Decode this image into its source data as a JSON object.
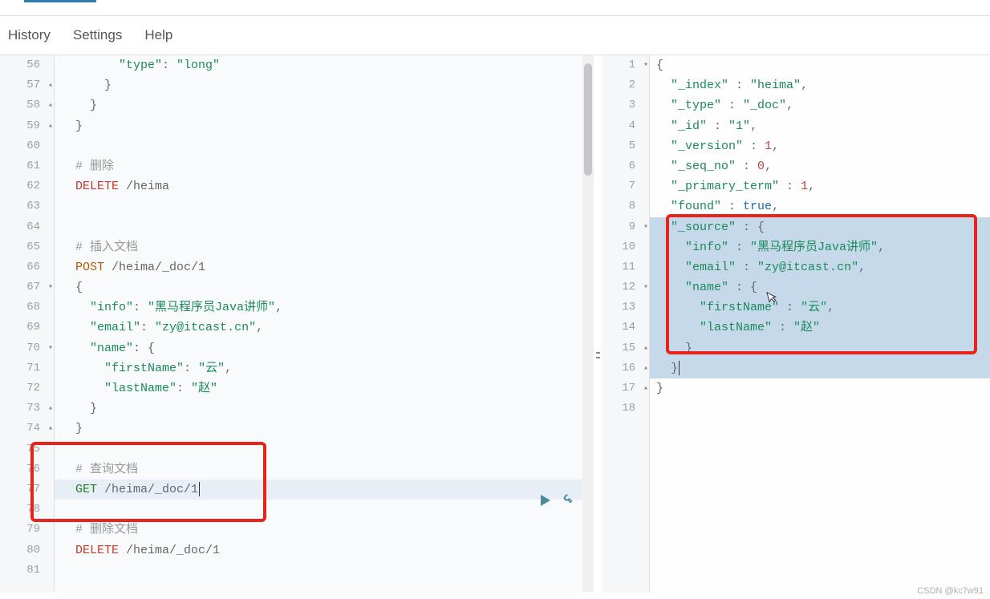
{
  "menu": {
    "history": "History",
    "settings": "Settings",
    "help": "Help"
  },
  "left": {
    "lines": {
      "56": {
        "indent": "        ",
        "tokens": [
          [
            "str",
            "\"type\""
          ],
          [
            "pun",
            ": "
          ],
          [
            "str",
            "\"long\""
          ]
        ]
      },
      "57": {
        "fold": "▴",
        "indent": "      ",
        "tokens": [
          [
            "pun",
            "}"
          ]
        ]
      },
      "58": {
        "fold": "▴",
        "indent": "    ",
        "tokens": [
          [
            "pun",
            "}"
          ]
        ]
      },
      "59": {
        "fold": "▴",
        "indent": "  ",
        "tokens": [
          [
            "pun",
            "}"
          ]
        ]
      },
      "60": {
        "indent": "",
        "tokens": []
      },
      "61": {
        "indent": "  ",
        "tokens": [
          [
            "cmt",
            "# 删除"
          ]
        ]
      },
      "62": {
        "indent": "  ",
        "tokens": [
          [
            "kw-delete",
            "DELETE"
          ],
          [
            "path",
            " /heima"
          ]
        ]
      },
      "63": {
        "indent": "",
        "tokens": []
      },
      "64": {
        "indent": "",
        "tokens": []
      },
      "65": {
        "indent": "  ",
        "tokens": [
          [
            "cmt",
            "# 插入文档"
          ]
        ]
      },
      "66": {
        "indent": "  ",
        "tokens": [
          [
            "kw-post",
            "POST"
          ],
          [
            "path",
            " /heima/_doc/1"
          ]
        ]
      },
      "67": {
        "fold": "▾",
        "indent": "  ",
        "tokens": [
          [
            "pun",
            "{"
          ]
        ]
      },
      "68": {
        "indent": "    ",
        "tokens": [
          [
            "str",
            "\"info\""
          ],
          [
            "pun",
            ": "
          ],
          [
            "str",
            "\"黑马程序员Java讲师\""
          ],
          [
            "pun",
            ","
          ]
        ]
      },
      "69": {
        "indent": "    ",
        "tokens": [
          [
            "str",
            "\"email\""
          ],
          [
            "pun",
            ": "
          ],
          [
            "str",
            "\"zy@itcast.cn\""
          ],
          [
            "pun",
            ","
          ]
        ]
      },
      "70": {
        "fold": "▾",
        "indent": "    ",
        "tokens": [
          [
            "str",
            "\"name\""
          ],
          [
            "pun",
            ": {"
          ]
        ]
      },
      "71": {
        "indent": "      ",
        "tokens": [
          [
            "str",
            "\"firstName\""
          ],
          [
            "pun",
            ": "
          ],
          [
            "str",
            "\"云\""
          ],
          [
            "pun",
            ","
          ]
        ]
      },
      "72": {
        "indent": "      ",
        "tokens": [
          [
            "str",
            "\"lastName\""
          ],
          [
            "pun",
            ": "
          ],
          [
            "str",
            "\"赵\""
          ]
        ]
      },
      "73": {
        "fold": "▴",
        "indent": "    ",
        "tokens": [
          [
            "pun",
            "}"
          ]
        ]
      },
      "74": {
        "fold": "▴",
        "indent": "  ",
        "tokens": [
          [
            "pun",
            "}"
          ]
        ]
      },
      "75": {
        "indent": "",
        "tokens": []
      },
      "76": {
        "indent": "  ",
        "tokens": [
          [
            "cmt",
            "# 查询文档"
          ]
        ]
      },
      "77": {
        "indent": "  ",
        "tokens": [
          [
            "kw-get",
            "GET"
          ],
          [
            "path",
            " /heima/_doc/1"
          ]
        ]
      },
      "78": {
        "indent": "",
        "tokens": []
      },
      "79": {
        "indent": "  ",
        "tokens": [
          [
            "cmt",
            "# 删除文档"
          ]
        ]
      },
      "80": {
        "indent": "  ",
        "tokens": [
          [
            "kw-delete",
            "DELETE"
          ],
          [
            "path",
            " /heima/_doc/1"
          ]
        ]
      },
      "81": {
        "indent": "",
        "tokens": []
      }
    }
  },
  "right": {
    "lines": {
      "1": {
        "fold": "▾",
        "indent": "",
        "tokens": [
          [
            "pun",
            "{"
          ]
        ]
      },
      "2": {
        "indent": "  ",
        "tokens": [
          [
            "key",
            "\"_index\""
          ],
          [
            "pun",
            " : "
          ],
          [
            "str",
            "\"heima\""
          ],
          [
            "pun",
            ","
          ]
        ]
      },
      "3": {
        "indent": "  ",
        "tokens": [
          [
            "key",
            "\"_type\""
          ],
          [
            "pun",
            " : "
          ],
          [
            "str",
            "\"_doc\""
          ],
          [
            "pun",
            ","
          ]
        ]
      },
      "4": {
        "indent": "  ",
        "tokens": [
          [
            "key",
            "\"_id\""
          ],
          [
            "pun",
            " : "
          ],
          [
            "str",
            "\"1\""
          ],
          [
            "pun",
            ","
          ]
        ]
      },
      "5": {
        "indent": "  ",
        "tokens": [
          [
            "key",
            "\"_version\""
          ],
          [
            "pun",
            " : "
          ],
          [
            "num",
            "1"
          ],
          [
            "pun",
            ","
          ]
        ]
      },
      "6": {
        "indent": "  ",
        "tokens": [
          [
            "key",
            "\"_seq_no\""
          ],
          [
            "pun",
            " : "
          ],
          [
            "num",
            "0"
          ],
          [
            "pun",
            ","
          ]
        ]
      },
      "7": {
        "indent": "  ",
        "tokens": [
          [
            "key",
            "\"_primary_term\""
          ],
          [
            "pun",
            " : "
          ],
          [
            "num",
            "1"
          ],
          [
            "pun",
            ","
          ]
        ]
      },
      "8": {
        "indent": "  ",
        "tokens": [
          [
            "key",
            "\"found\""
          ],
          [
            "pun",
            " : "
          ],
          [
            "bool",
            "true"
          ],
          [
            "pun",
            ","
          ]
        ]
      },
      "9": {
        "fold": "▾",
        "hl": true,
        "indent": "  ",
        "tokens": [
          [
            "key",
            "\"_source\""
          ],
          [
            "pun",
            " : {"
          ]
        ]
      },
      "10": {
        "hl": true,
        "indent": "    ",
        "tokens": [
          [
            "key",
            "\"info\""
          ],
          [
            "pun",
            " : "
          ],
          [
            "str",
            "\"黑马程序员Java讲师\""
          ],
          [
            "pun",
            ","
          ]
        ]
      },
      "11": {
        "hl": true,
        "indent": "    ",
        "tokens": [
          [
            "key",
            "\"email\""
          ],
          [
            "pun",
            " : "
          ],
          [
            "str",
            "\"zy@itcast.cn\""
          ],
          [
            "pun",
            ","
          ]
        ]
      },
      "12": {
        "fold": "▾",
        "hl": true,
        "indent": "    ",
        "tokens": [
          [
            "key",
            "\"name\""
          ],
          [
            "pun",
            " : {"
          ]
        ]
      },
      "13": {
        "hl": true,
        "indent": "      ",
        "tokens": [
          [
            "key",
            "\"firstName\""
          ],
          [
            "pun",
            " : "
          ],
          [
            "str",
            "\"云\""
          ],
          [
            "pun",
            ","
          ]
        ]
      },
      "14": {
        "hl": true,
        "indent": "      ",
        "tokens": [
          [
            "key",
            "\"lastName\""
          ],
          [
            "pun",
            " : "
          ],
          [
            "str",
            "\"赵\""
          ]
        ]
      },
      "15": {
        "fold": "▴",
        "hl": true,
        "indent": "    ",
        "tokens": [
          [
            "pun",
            "}"
          ]
        ]
      },
      "16": {
        "fold": "▴",
        "hl": true,
        "indent": "  ",
        "tokens": [
          [
            "pun",
            "}"
          ]
        ]
      },
      "17": {
        "fold": "▴",
        "indent": "",
        "tokens": [
          [
            "pun",
            "}"
          ]
        ]
      },
      "18": {
        "indent": "",
        "tokens": []
      }
    }
  },
  "watermark": "CSDN @kc7w91"
}
